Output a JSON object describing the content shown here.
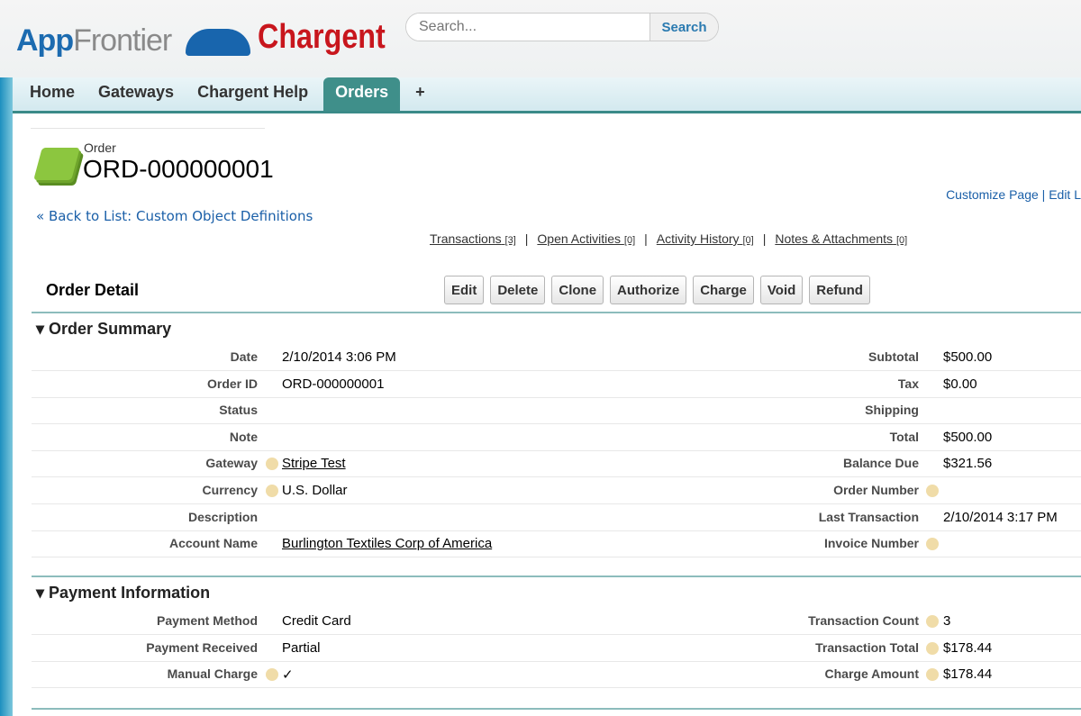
{
  "header": {
    "logo_left": "AppFrontier",
    "logo_left_a": "App",
    "logo_left_b": "Frontier",
    "logo_right": "Chargent",
    "search_placeholder": "Search...",
    "search_button": "Search"
  },
  "tabs": [
    "Home",
    "Gateways",
    "Chargent Help",
    "Orders",
    "+"
  ],
  "record": {
    "object_label": "Order",
    "name": "ORD-000000001",
    "back_link": "« Back to List: Custom Object Definitions",
    "customize": "Customize Page | Edit L"
  },
  "related": [
    {
      "label": "Transactions",
      "count": "[3]"
    },
    {
      "label": "Open Activities",
      "count": "[0]"
    },
    {
      "label": "Activity History",
      "count": "[0]"
    },
    {
      "label": "Notes & Attachments",
      "count": "[0]"
    }
  ],
  "detail_title": "Order Detail",
  "buttons": [
    "Edit",
    "Delete",
    "Clone",
    "Authorize",
    "Charge",
    "Void",
    "Refund"
  ],
  "summary": {
    "title": "Order Summary",
    "rows": [
      {
        "l1": "Date",
        "v1": "2/10/2014 3:06 PM",
        "l2": "Subtotal",
        "v2": "$500.00"
      },
      {
        "l1": "Order ID",
        "v1": "ORD-000000001",
        "l2": "Tax",
        "v2": "$0.00"
      },
      {
        "l1": "Status",
        "v1": "",
        "l2": "Shipping",
        "v2": ""
      },
      {
        "l1": "Note",
        "v1": "",
        "l2": "Total",
        "v2": "$500.00"
      },
      {
        "l1": "Gateway",
        "v1": "Stripe Test",
        "l2": "Balance Due",
        "v2": "$321.56"
      },
      {
        "l1": "Currency",
        "v1": "U.S. Dollar",
        "l2": "Order Number",
        "v2": ""
      },
      {
        "l1": "Description",
        "v1": "",
        "l2": "Last Transaction",
        "v2": "2/10/2014 3:17 PM"
      },
      {
        "l1": "Account Name",
        "v1": "Burlington Textiles Corp of America",
        "l2": "Invoice Number",
        "v2": ""
      }
    ]
  },
  "payment": {
    "title": "Payment Information",
    "rows": [
      {
        "l1": "Payment Method",
        "v1": "Credit Card",
        "l2": "Transaction Count",
        "v2": "3"
      },
      {
        "l1": "Payment Received",
        "v1": "Partial",
        "l2": "Transaction Total",
        "v2": "$178.44"
      },
      {
        "l1": "Manual Charge",
        "v1": "✓",
        "l2": "Charge Amount",
        "v2": "$178.44"
      }
    ]
  }
}
